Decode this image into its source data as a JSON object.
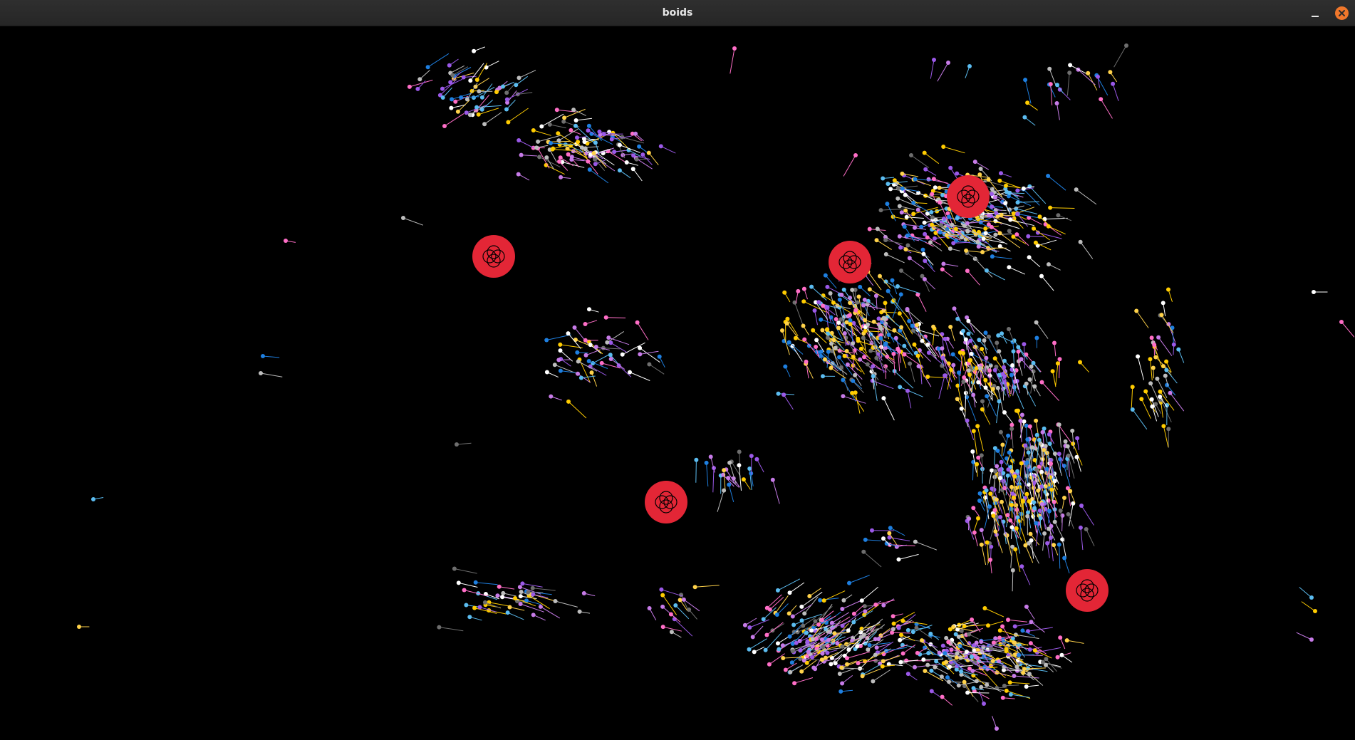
{
  "window": {
    "title": "boids",
    "minimize_icon": "minimize-icon",
    "close_icon": "close-icon"
  },
  "colors": {
    "background": "#000000",
    "obstacle": "#e32636",
    "boid_palette": [
      "#ffcc00",
      "#ffffff",
      "#1e7fe0",
      "#5bbcf0",
      "#9b59e8",
      "#c77be8",
      "#ff6ec7",
      "#bdbdbd",
      "#6e6e6e",
      "#ffd24a"
    ]
  },
  "obstacles": {
    "count": 5,
    "icon": "four-circle-knot-icon"
  }
}
